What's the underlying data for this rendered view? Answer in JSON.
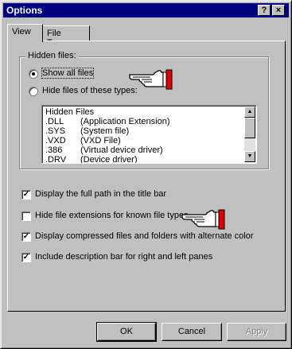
{
  "window": {
    "title": "Options",
    "help_button": "?",
    "close_button": "×"
  },
  "tabs": [
    {
      "label": "View",
      "active": true
    },
    {
      "label": "File Types",
      "active": false
    }
  ],
  "hidden_files": {
    "group_label": "Hidden files:",
    "option_show_all": "Show all files",
    "option_hide_types": "Hide files of these types:",
    "selected": "Show all files",
    "list_header": "Hidden Files",
    "list_items": [
      {
        "ext": ".DLL",
        "desc": "(Application Extension)"
      },
      {
        "ext": ".SYS",
        "desc": "(System file)"
      },
      {
        "ext": ".VXD",
        "desc": "(VXD File)"
      },
      {
        "ext": ".386",
        "desc": "(Virtual device driver)"
      },
      {
        "ext": ".DRV",
        "desc": "(Device driver)"
      }
    ]
  },
  "checkboxes": [
    {
      "label": "Display the full path in the title bar",
      "checked": true
    },
    {
      "label": "Hide file extensions for known file types",
      "checked": false
    },
    {
      "label": "Display compressed files and folders with alternate color",
      "checked": true
    },
    {
      "label": "Include description bar for right and left panes",
      "checked": true
    }
  ],
  "buttons": {
    "ok": "OK",
    "cancel": "Cancel",
    "apply": "Apply"
  },
  "icons": {
    "pointer": "pointing-hand-icon",
    "scroll_up": "arrow-up-icon",
    "scroll_down": "arrow-down-icon"
  },
  "colors": {
    "titlebar": "#000080",
    "face": "#c0c0c0",
    "hand_cuff": "#e00000"
  }
}
